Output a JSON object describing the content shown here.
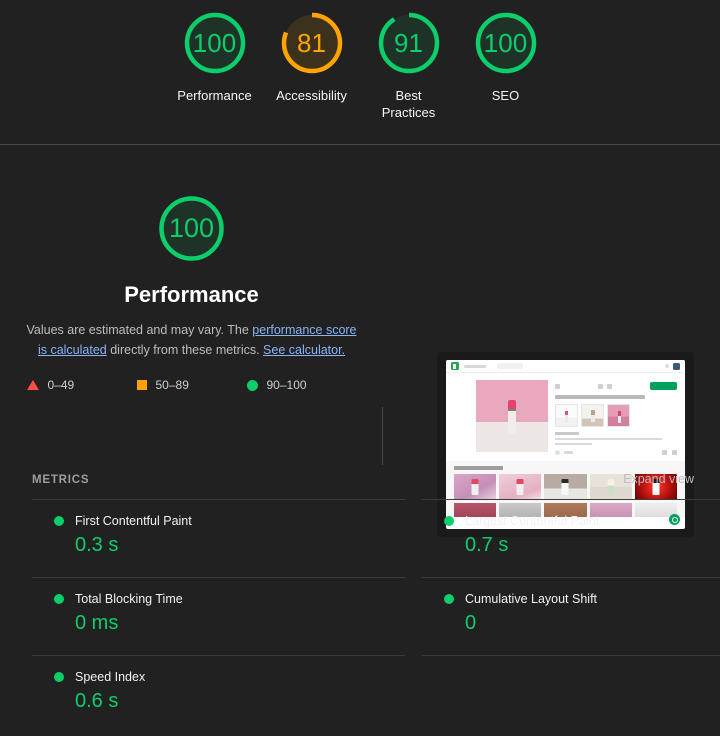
{
  "theme": {
    "background": "#212121",
    "pass_color": "#0cce6b",
    "average_color": "#ffa400",
    "fail_color": "#ff4e42",
    "link_color": "#8ab4f8",
    "divider_color": "#4a4a4a"
  },
  "category_gauges": [
    {
      "score": "100",
      "label": "Performance",
      "color": "#0cce6b",
      "pct": 100
    },
    {
      "score": "81",
      "label": "Accessibility",
      "color": "#ffa400",
      "pct": 81
    },
    {
      "score": "91",
      "label": "Best\nPractices",
      "label_line1": "Best",
      "label_line2": "Practices",
      "color": "#0cce6b",
      "pct": 91
    },
    {
      "score": "100",
      "label": "SEO",
      "color": "#0cce6b",
      "pct": 100
    }
  ],
  "performance_section": {
    "gauge_score": "100",
    "title": "Performance",
    "description_part1": "Values are estimated and may vary. The ",
    "link1": "performance score is calculated",
    "description_part2": " directly from these metrics. ",
    "link2": "See calculator.",
    "legend": [
      {
        "marker": "triangle",
        "range": "0–49",
        "color": "#ff4e42"
      },
      {
        "marker": "square",
        "range": "50–89",
        "color": "#ffa400"
      },
      {
        "marker": "circle",
        "range": "90–100",
        "color": "#0cce6b"
      }
    ]
  },
  "metrics": {
    "heading": "METRICS",
    "expand_view": "Expand view",
    "left_column": [
      {
        "name": "First Contentful Paint",
        "value": "0.3 s",
        "status": "pass"
      },
      {
        "name": "Total Blocking Time",
        "value": "0 ms",
        "status": "pass"
      },
      {
        "name": "Speed Index",
        "value": "0.6 s",
        "status": "pass"
      }
    ],
    "right_column": [
      {
        "name": "Largest Contentful Paint",
        "value": "0.7 s",
        "status": "pass"
      },
      {
        "name": "Cumulative Layout Shift",
        "value": "0",
        "status": "pass"
      }
    ]
  },
  "screenshot_thumbnail": {
    "alt": "Final page screenshot of a stock photo site showing a pink lipstick product page"
  }
}
